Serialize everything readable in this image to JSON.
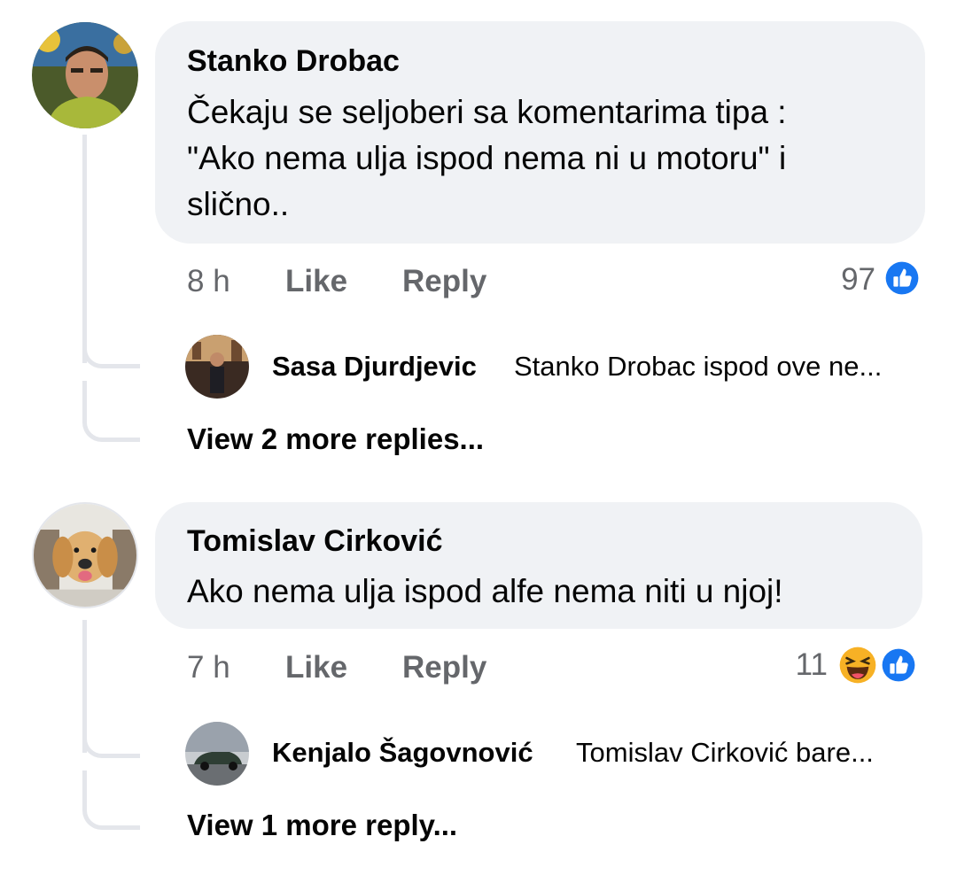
{
  "comments": [
    {
      "author": "Stanko Drobac",
      "text_lines": [
        "Čekaju se seljoberi sa komentarima tipa :",
        "\"Ako nema ulja ispod nema ni u motoru\" i",
        "slično.."
      ],
      "time": "8 h",
      "like_label": "Like",
      "reply_label": "Reply",
      "reaction_count": "97",
      "reactions": [
        "like-icon"
      ],
      "reply_preview": {
        "name": "Sasa Djurdjevic",
        "text": "Stanko Drobac ispod ove ne..."
      },
      "view_more": "View 2 more replies..."
    },
    {
      "author": "Tomislav Cirković",
      "text_lines": [
        "Ako nema ulja ispod alfe nema niti u njoj!"
      ],
      "time": "7 h",
      "like_label": "Like",
      "reply_label": "Reply",
      "reaction_count": "11",
      "reactions": [
        "haha-icon",
        "like-icon"
      ],
      "reply_preview": {
        "name": "Kenjalo Šagovnović",
        "text": "Tomislav Cirković bare..."
      },
      "view_more": "View 1 more reply..."
    }
  ],
  "colors": {
    "bubble": "#f0f2f5",
    "secondary_text": "#65676b",
    "like_blue": "#1877f2",
    "haha_yellow": "#f7b125",
    "thread_line": "#e4e6eb"
  }
}
